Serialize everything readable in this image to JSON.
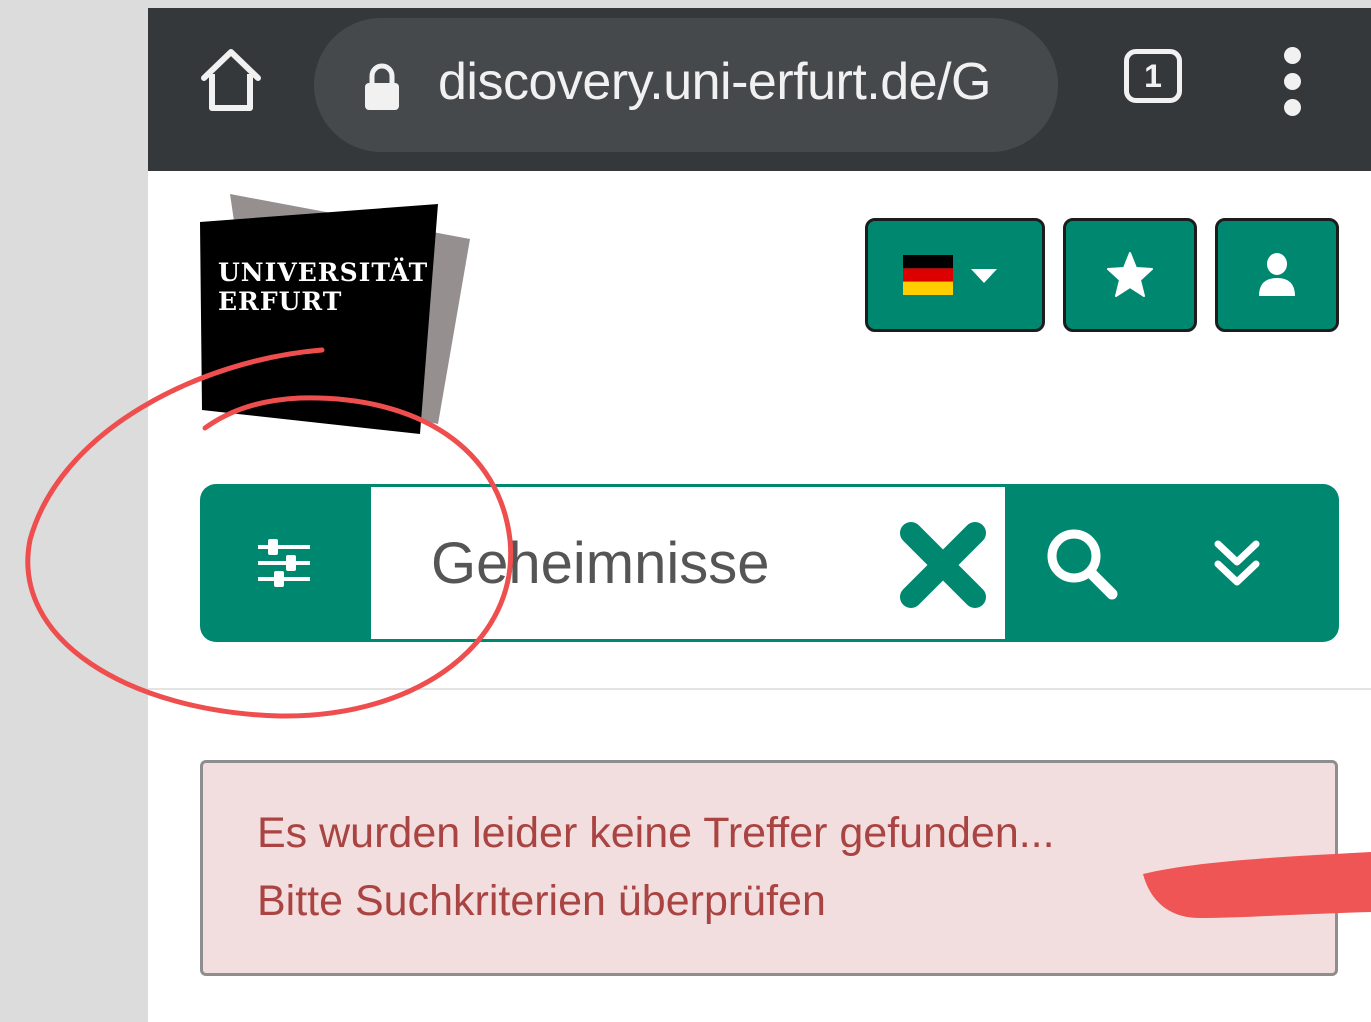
{
  "browser": {
    "url_text": "discovery.uni-erfurt.de/G",
    "tab_count": "1",
    "icons": [
      "home-icon",
      "lock-icon",
      "tab-switcher-icon",
      "more-vert-icon"
    ]
  },
  "logo": {
    "line1": "UNIVERSITÄT",
    "line2": "ERFURT"
  },
  "header": {
    "language_flag": "german-flag-icon",
    "favorites_icon": "star-icon",
    "account_icon": "user-icon"
  },
  "search": {
    "value": "Geheimnisse",
    "filter_icon": "sliders-icon",
    "clear_icon": "close-x-icon",
    "search_icon": "search-icon",
    "expand_icon": "chevron-double-down-icon"
  },
  "alert": {
    "line1": "Es wurden leider keine Treffer gefunden...",
    "line2": "Bitte Suchkriterien überprüfen"
  },
  "colors": {
    "accent": "#008770",
    "topbar": "#35383b",
    "alert_bg": "#f2dede",
    "alert_text": "#a94442",
    "annotation": "#ef4e4e"
  }
}
